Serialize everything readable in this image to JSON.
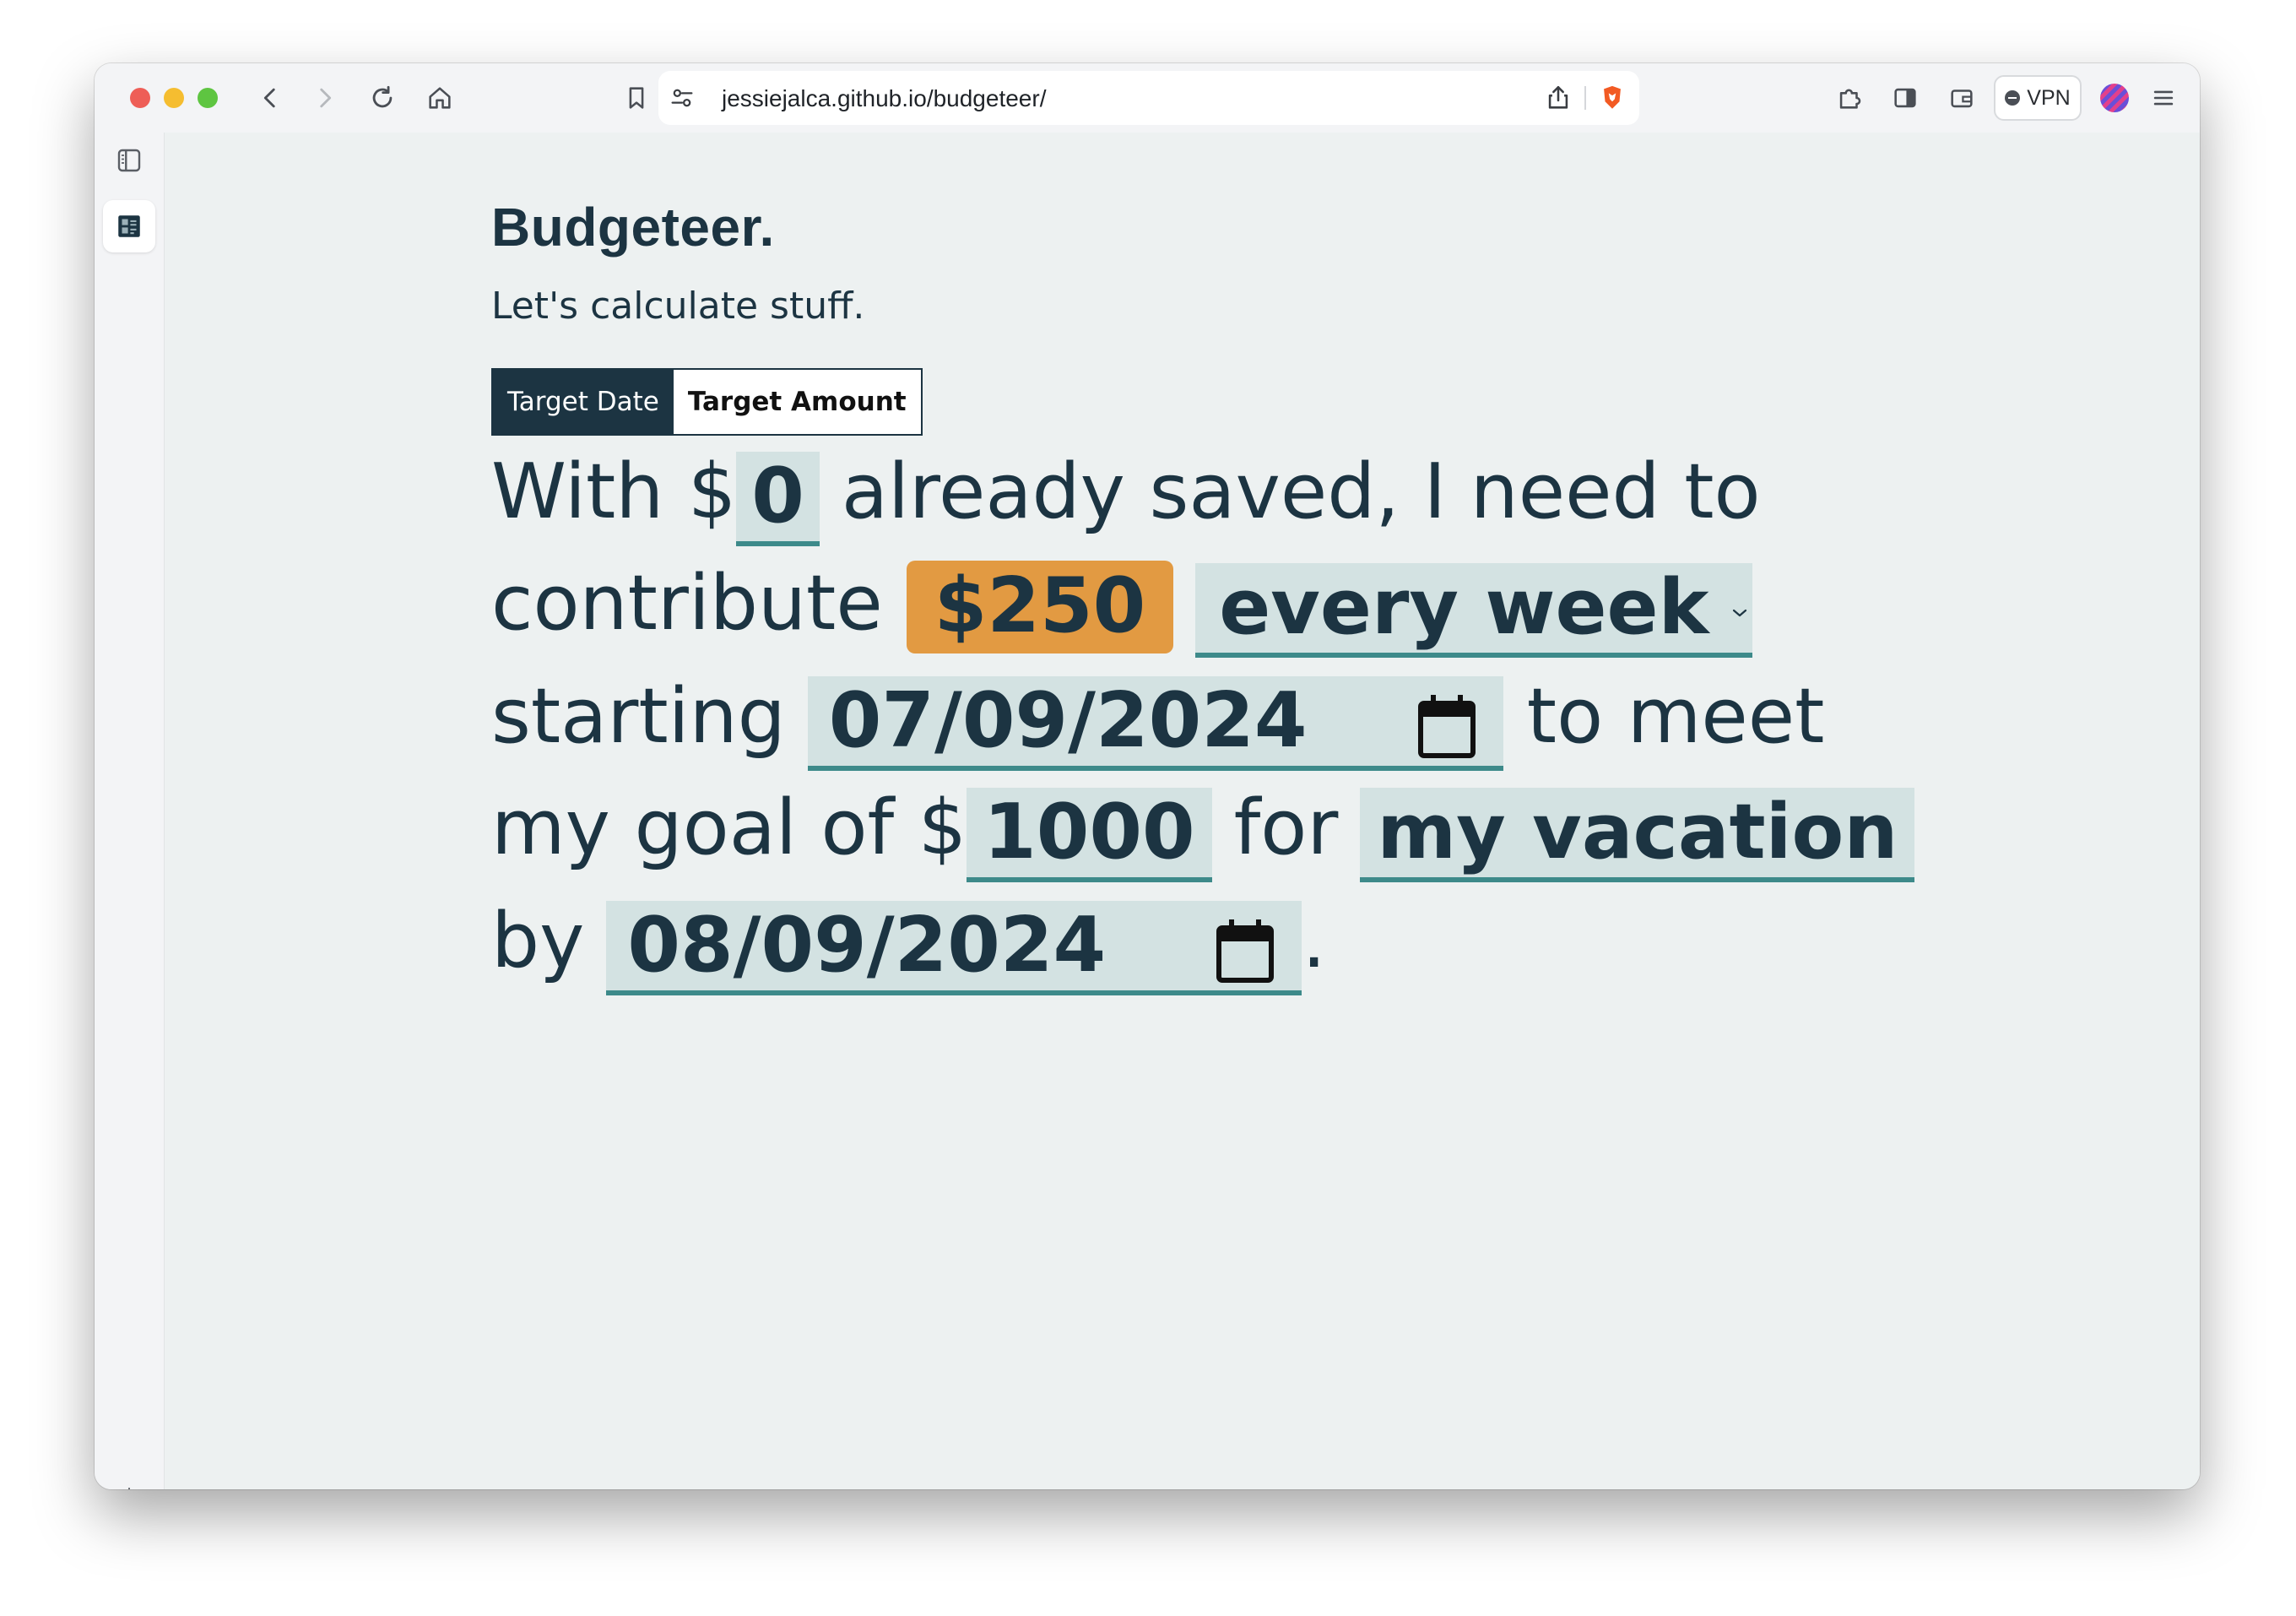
{
  "browser": {
    "url": "jessiejalca.github.io/budgeteer/",
    "vpn_label": "VPN"
  },
  "app": {
    "title": "Budgeteer.",
    "subtitle": "Let's calculate stuff.",
    "tabs": [
      {
        "label": "Target Date",
        "active": true
      },
      {
        "label": "Target Amount",
        "active": false
      }
    ]
  },
  "sentence": {
    "t_with": "With $",
    "saved_amount": "0",
    "t_already": "already saved, I need to",
    "t_contribute": "contribute",
    "contribution": "$250",
    "frequency": "every week",
    "t_starting": "starting",
    "start_date": "07/09/2024",
    "t_to_meet": "to meet",
    "t_my_goal": "my goal of $",
    "goal_amount": "1000",
    "t_for": "for",
    "goal_name": "my vacation",
    "t_by": "by",
    "end_date": "08/09/2024",
    "t_period": "."
  },
  "colors": {
    "text": "#1c3442",
    "field_bg": "#d3e2e2",
    "field_underline": "#3d8a8a",
    "highlight": "#e29a42",
    "tab_active_bg": "#1c3442"
  }
}
